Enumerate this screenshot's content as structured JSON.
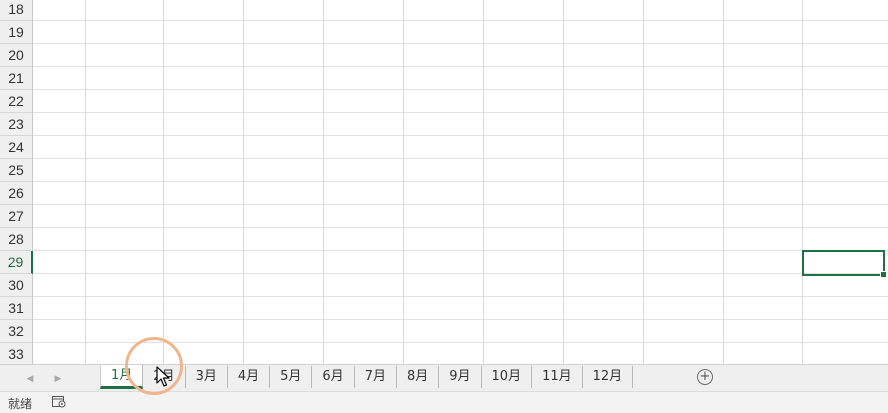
{
  "grid": {
    "row_numbers": [
      "18",
      "19",
      "20",
      "21",
      "22",
      "23",
      "24",
      "25",
      "26",
      "27",
      "28",
      "29",
      "30",
      "31",
      "32",
      "33"
    ],
    "active_row": "29"
  },
  "sheet_tabs": [
    "1月",
    "2月",
    "3月",
    "4月",
    "5月",
    "6月",
    "7月",
    "8月",
    "9月",
    "10月",
    "11月",
    "12月"
  ],
  "active_sheet": "1月",
  "add_sheet_label": "+",
  "status": {
    "text": "就绪"
  },
  "colors": {
    "accent": "#1e7145",
    "highlight_ring": "#f0b58c"
  }
}
